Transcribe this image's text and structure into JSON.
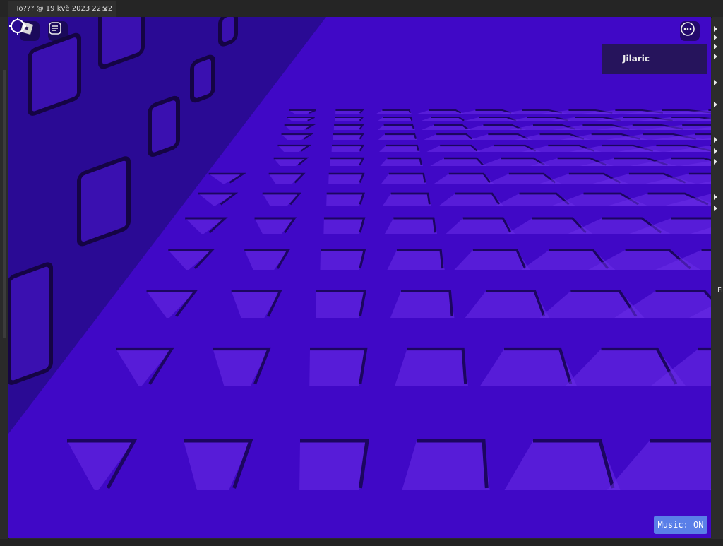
{
  "tab": {
    "title": "To??? @ 19 kvě 2023 22:32",
    "close": "✕"
  },
  "hud": {
    "roblox_menu_icon": "roblox-logo-icon",
    "chat_icon": "chat-icon",
    "more_icon": "more-icon",
    "player_name": "Jilaric",
    "music_button": "Music: ON"
  },
  "right_panel": {
    "label": "Fi"
  },
  "colors": {
    "floor": "#4008c6",
    "wall": "#2a0a94",
    "tile_edge": "#6a2ee8",
    "tile_shadow": "#1c0660",
    "music_bg": "#5a7fe8"
  }
}
